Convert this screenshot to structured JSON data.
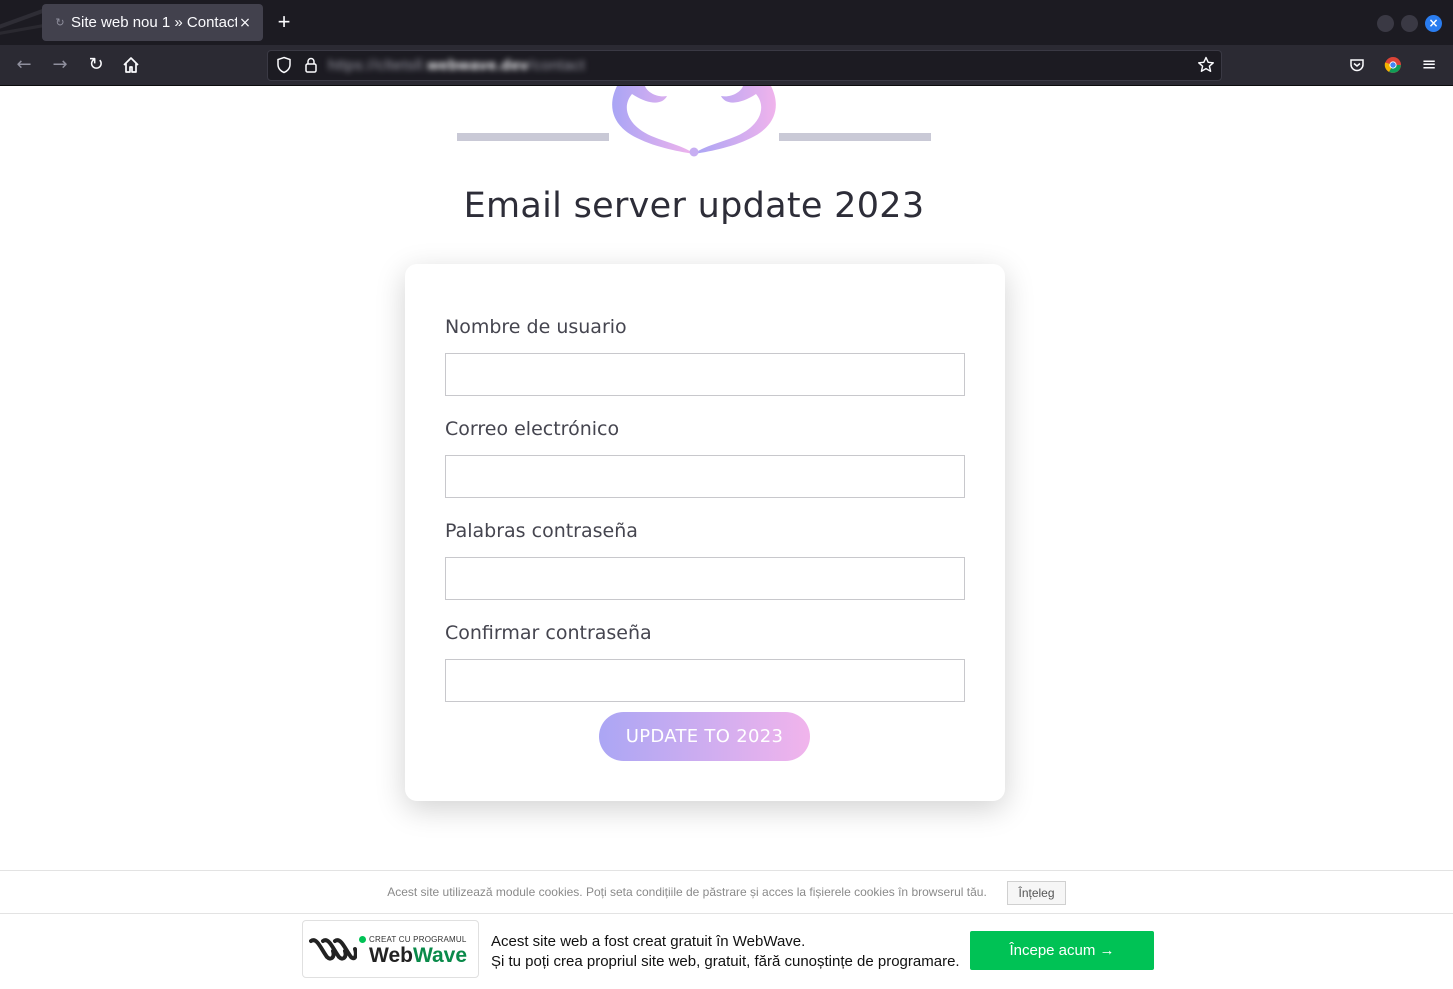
{
  "browser": {
    "tab_title": "Site web nou 1 » Contact",
    "tab_close": "×",
    "new_tab": "+",
    "url_prefix": "https://cltetsll.",
    "url_domain": "webwave.dev",
    "url_path": "/contact"
  },
  "page": {
    "title": "Email server update 2023",
    "fields": [
      {
        "label": "Nombre de usuario",
        "value": ""
      },
      {
        "label": "Correo electrónico",
        "value": ""
      },
      {
        "label": "Palabras contraseña",
        "value": ""
      },
      {
        "label": "Confirmar contraseña",
        "value": ""
      }
    ],
    "submit_label": "UPDATE TO 2023",
    "accent_gradient": [
      "#aba6f4",
      "#f1b4ec"
    ]
  },
  "cookie": {
    "text": "Acest site utilizează module cookies. Poți seta condițiile de păstrare și acces la fișierele cookies în browserul tău.",
    "button": "Înțeleg"
  },
  "webwave": {
    "badge_small": "CREAT CU PROGRAMUL",
    "badge_name_a": "Web",
    "badge_name_b": "Wave",
    "line1": "Acest site web a fost creat gratuit în WebWave.",
    "line2": "Și tu poți crea propriul site web, gratuit, fără cunoștințe de programare.",
    "cta": "Începe acum →",
    "accent": "#00c255"
  }
}
